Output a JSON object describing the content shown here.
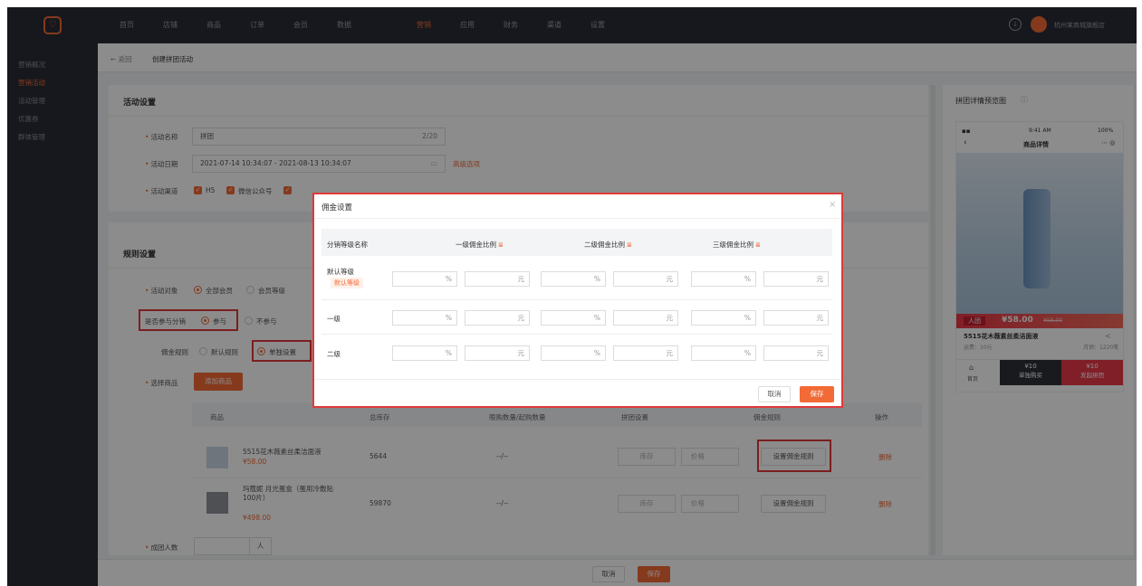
{
  "topnav": {
    "logo_glyph": "♡",
    "items": [
      "首页",
      "店铺",
      "商品",
      "订单",
      "会员",
      "数据",
      "营销",
      "应用",
      "财务",
      "渠道",
      "设置"
    ],
    "active_index": 6,
    "user_name": "杭州某商城旗舰店"
  },
  "sidebar": {
    "items": [
      "营销概况",
      "营销活动",
      "活动管理",
      "优惠券",
      "群体管理"
    ],
    "active_index": 1
  },
  "breadcrumb": {
    "back": "← 返回",
    "current": "创建拼团活动"
  },
  "activity": {
    "section_title": "活动设置",
    "name_label": "活动名称",
    "name_value": "拼团",
    "name_count": "2/20",
    "date_label": "活动日期",
    "date_value": "2021-07-14 10:34:07 - 2021-08-13 10:34:07",
    "date_link": "高级选项",
    "channel_label": "活动渠道",
    "channels": [
      "H5",
      "微信公众号"
    ]
  },
  "rules": {
    "section_title": "规则设置",
    "target_label": "活动对象",
    "target_options": [
      "全部会员",
      "会员等级"
    ],
    "distribution_label": "是否参与分销",
    "distribution_options": [
      "参与",
      "不参与"
    ],
    "commission_label": "佣金规则",
    "commission_options": [
      "默认规则",
      "单独设置"
    ],
    "goods_label": "选择商品",
    "add_goods_button": "添加商品",
    "group_size_label": "成团人数",
    "group_size_unit": "人"
  },
  "table": {
    "headers": [
      "商品",
      "总库存",
      "限购数量/起购数量",
      "拼团设置",
      "佣金规则",
      "操作"
    ],
    "rows": [
      {
        "name": "5515花木薇素丝柔洁面液",
        "price": "¥58.00",
        "stock": "5644",
        "limit": "--/--",
        "stock_ph": "库存",
        "price_ph": "价格",
        "rule_btn": "设置佣金规则",
        "action": "删除"
      },
      {
        "name": "玛蔻妮 月光蛋盒（蛋用冷敷贴100片）",
        "price": "¥498.00",
        "stock": "59870",
        "limit": "--/--",
        "stock_ph": "库存",
        "price_ph": "价格",
        "rule_btn": "设置佣金规则",
        "action": "删除"
      }
    ]
  },
  "bottom": {
    "cancel": "取消",
    "save": "保存"
  },
  "preview": {
    "title": "拼团详情预览图",
    "status_left": "9:41 AM",
    "status_right": "100%",
    "page_title": "商品详情",
    "tag": "人团",
    "price": "¥58.00",
    "orig_price": "¥58.00",
    "product": "5515花木薇素丝柔洁面液",
    "freight": "运费：10元",
    "sales": "月销：1220笔",
    "home": "首页",
    "buy_price": "¥10",
    "buy_label": "单独购买",
    "group_price": "¥10",
    "group_label": "发起拼团"
  },
  "modal": {
    "title": "佣金设置",
    "close": "×",
    "headers": [
      "分销等级名称",
      "一级佣金比例",
      "二级佣金比例",
      "三级佣金比例"
    ],
    "rows": [
      {
        "name": "默认等级",
        "tag": "默认等级"
      },
      {
        "name": "一级",
        "tag": ""
      },
      {
        "name": "二级",
        "tag": ""
      }
    ],
    "pct_unit": "%",
    "yuan_unit": "元",
    "cancel": "取消",
    "save": "保存"
  }
}
